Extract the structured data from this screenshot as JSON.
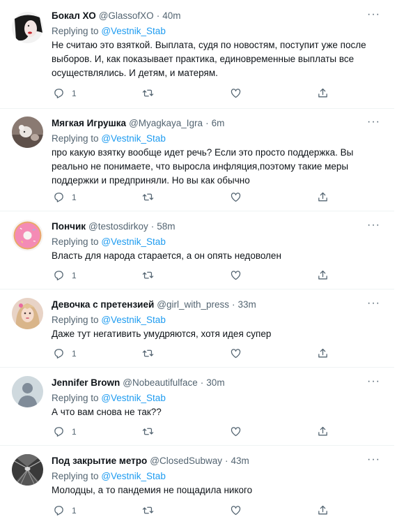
{
  "tweets": [
    {
      "name": "Бокал ХО",
      "handle": "@GlassofXO",
      "time": "40m",
      "replying_label": "Replying to",
      "replying_to": "@Vestnik_Stab",
      "lines": [
        "Не считаю это взяткой. Выплата, судя по новостям, поступит уже после",
        "выборов. И, как показывает практика, единовременные выплаты все",
        "осуществлялись. И детям, и матерям."
      ],
      "reply_count": "1",
      "avatar": "dark-portrait"
    },
    {
      "name": "Мягкая Игрушка",
      "handle": "@Myagkaya_Igra",
      "time": "6m",
      "replying_label": "Replying to",
      "replying_to": "@Vestnik_Stab",
      "lines": [
        "про какую взятку вообще идет речь? Если это просто поддержка. Вы",
        "реально не понимаете, что выросла инфляция,поэтому такие меры",
        "поддержки и предприняли. Но вы как обычно"
      ],
      "reply_count": "1",
      "avatar": "soft-toy-photo"
    },
    {
      "name": "Пончик",
      "handle": "@testosdirkoy",
      "time": "58m",
      "replying_label": "Replying to",
      "replying_to": "@Vestnik_Stab",
      "lines": [
        "Власть для народа старается, а он опять недоволен"
      ],
      "reply_count": "1",
      "avatar": "pink-donut"
    },
    {
      "name": "Девочка с претензией",
      "handle": "@girl_with_press",
      "time": "33m",
      "replying_label": "Replying to",
      "replying_to": "@Vestnik_Stab",
      "lines": [
        "Даже тут негативить умудряются, хотя идея супер"
      ],
      "reply_count": "1",
      "avatar": "blonde-girl"
    },
    {
      "name": "Jennifer Brown",
      "handle": "@Nobeautifulface",
      "time": "30m",
      "replying_label": "Replying to",
      "replying_to": "@Vestnik_Stab",
      "lines": [
        "А что вам снова не так??"
      ],
      "reply_count": "1",
      "avatar": "default-silhouette"
    },
    {
      "name": "Под закрытие метро",
      "handle": "@ClosedSubway",
      "time": "43m",
      "replying_label": "Replying to",
      "replying_to": "@Vestnik_Stab",
      "lines": [
        "Молодцы, а то пандемия не пощадила никого"
      ],
      "reply_count": "1",
      "avatar": "metro-tunnel"
    }
  ],
  "separator": "·",
  "more_glyph": "···",
  "colors": {
    "link": "#1d9bf0",
    "secondary": "#536471",
    "text": "#0f1419",
    "divider": "#eff3f4"
  },
  "icons": [
    "reply-icon",
    "retweet-icon",
    "like-icon",
    "share-icon",
    "more-icon"
  ]
}
